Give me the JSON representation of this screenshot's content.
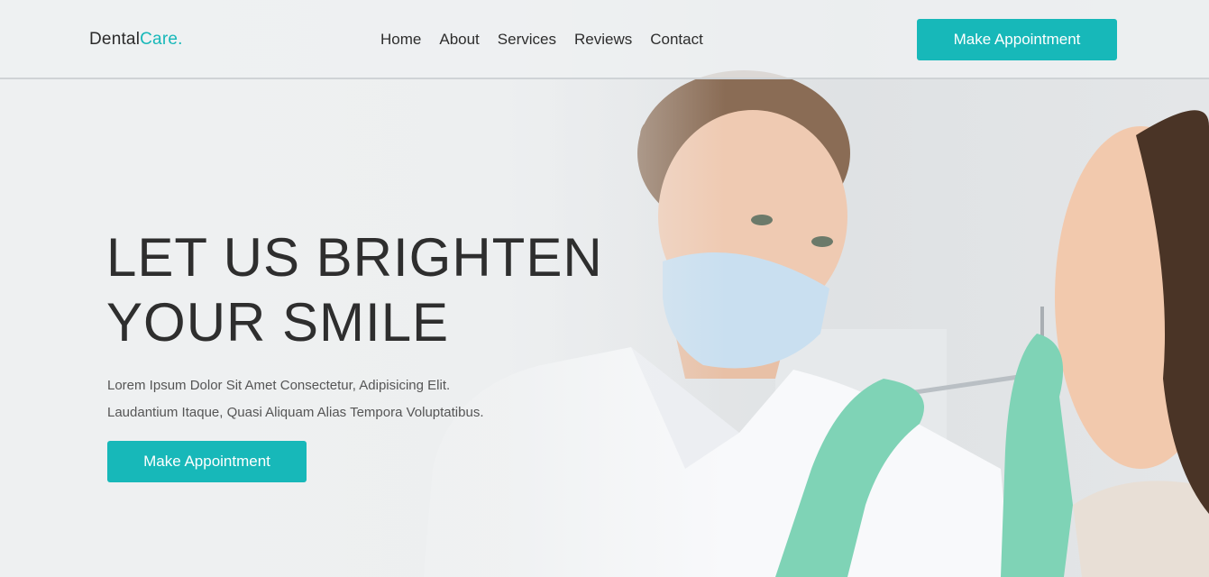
{
  "header": {
    "logo_main": "Dental",
    "logo_accent": "Care.",
    "nav": [
      {
        "label": "Home"
      },
      {
        "label": "About"
      },
      {
        "label": "Services"
      },
      {
        "label": "Reviews"
      },
      {
        "label": "Contact"
      }
    ],
    "cta_label": "Make Appointment"
  },
  "hero": {
    "title_line1": "LET US BRIGHTEN",
    "title_line2": "YOUR SMILE",
    "desc_line1": "Lorem Ipsum Dolor Sit Amet Consectetur, Adipisicing Elit.",
    "desc_line2": "Laudantium Itaque, Quasi Aliquam Alias Tempora Voluptatibus.",
    "cta_label": "Make Appointment"
  },
  "colors": {
    "accent": "#17b8b9",
    "text_dark": "#2e2e2e"
  }
}
